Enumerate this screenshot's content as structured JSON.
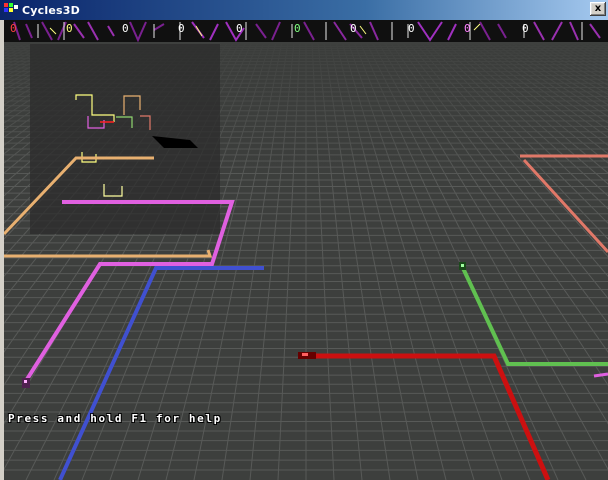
{
  "window": {
    "title": "Cycles3D",
    "close_label": "x"
  },
  "hud": {
    "scores": [
      {
        "value": "0",
        "color": "#ff4040"
      },
      {
        "value": "0",
        "color": "#ffff80"
      },
      {
        "value": "0",
        "color": "#ffffff"
      },
      {
        "value": "0",
        "color": "#ffffff"
      },
      {
        "value": "0",
        "color": "#ffffff"
      },
      {
        "value": "0",
        "color": "#80ff80"
      },
      {
        "value": "0",
        "color": "#ffffff"
      },
      {
        "value": "0",
        "color": "#ffffff"
      },
      {
        "value": "0",
        "color": "#ff80ff"
      },
      {
        "value": "0",
        "color": "#ffffff"
      }
    ]
  },
  "game": {
    "help_text": "Press and hold F1 for help"
  },
  "colors": {
    "floor": "#3a3c3a",
    "grid": "#565856",
    "trail_blue": "#4050d0",
    "trail_pink": "#e060e0",
    "trail_orange": "#e8b070",
    "trail_red": "#cc1010",
    "trail_green": "#60c050",
    "trail_salmon": "#e07868"
  }
}
